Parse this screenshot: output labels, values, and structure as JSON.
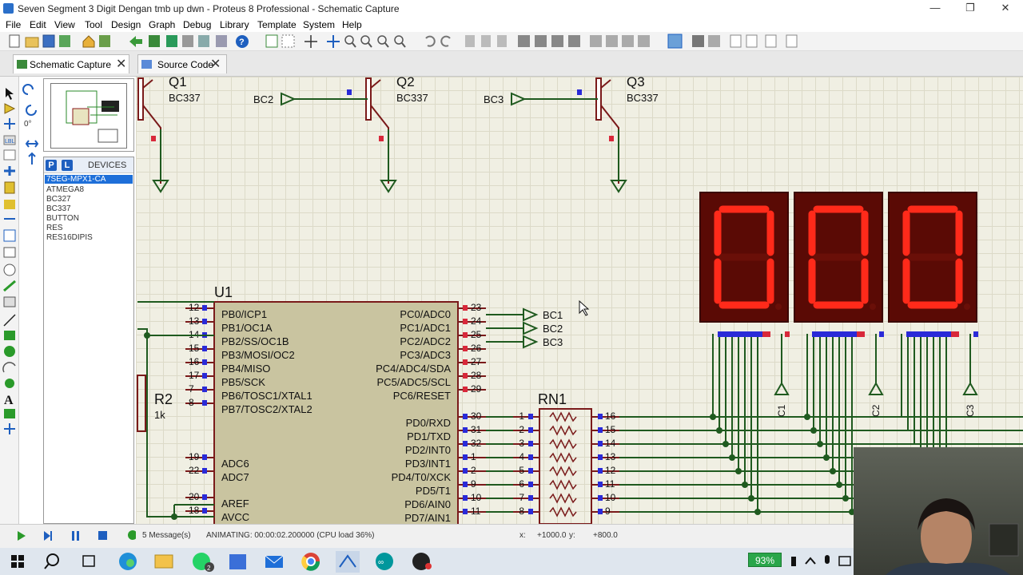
{
  "window": {
    "title": "Seven Segment 3 Digit Dengan tmb up dwn - Proteus 8 Professional - Schematic Capture",
    "minimize": "—",
    "restore": "❐",
    "close": "✕"
  },
  "menu": [
    "File",
    "Edit",
    "View",
    "Tool",
    "Design",
    "Graph",
    "Debug",
    "Library",
    "Template",
    "System",
    "Help"
  ],
  "tabs": [
    {
      "label": "Schematic Capture",
      "close": "✕"
    },
    {
      "label": "Source Code",
      "close": "✕"
    }
  ],
  "left_panel": {
    "rotation": "0°",
    "device_mode_p": "P",
    "device_mode_l": "L",
    "devices_title": "DEVICES",
    "devices": [
      "7SEG-MPX1-CA",
      "ATMEGA8",
      "BC327",
      "BC337",
      "BUTTON",
      "RES",
      "RES16DIPIS"
    ]
  },
  "schematic": {
    "transistors": [
      {
        "ref": "Q1",
        "value": "BC337",
        "input": ""
      },
      {
        "ref": "Q2",
        "value": "BC337",
        "input": "BC2"
      },
      {
        "ref": "Q3",
        "value": "BC337",
        "input": "BC3"
      }
    ],
    "mcu_ref": "U1",
    "mcu_left_pins": [
      {
        "num": "12",
        "name": "PB0/ICP1"
      },
      {
        "num": "13",
        "name": "PB1/OC1A"
      },
      {
        "num": "14",
        "name": "PB2/SS/OC1B"
      },
      {
        "num": "15",
        "name": "PB3/MOSI/OC2"
      },
      {
        "num": "16",
        "name": "PB4/MISO"
      },
      {
        "num": "17",
        "name": "PB5/SCK"
      },
      {
        "num": "7",
        "name": "PB6/TOSC1/XTAL1"
      },
      {
        "num": "8",
        "name": "PB7/TOSC2/XTAL2"
      },
      {
        "num": "19",
        "name": "ADC6"
      },
      {
        "num": "22",
        "name": "ADC7"
      },
      {
        "num": "20",
        "name": "AREF"
      },
      {
        "num": "18",
        "name": "AVCC"
      }
    ],
    "mcu_right_pins": [
      {
        "num": "23",
        "name": "PC0/ADC0"
      },
      {
        "num": "24",
        "name": "PC1/ADC1"
      },
      {
        "num": "25",
        "name": "PC2/ADC2"
      },
      {
        "num": "26",
        "name": "PC3/ADC3"
      },
      {
        "num": "27",
        "name": "PC4/ADC4/SDA"
      },
      {
        "num": "28",
        "name": "PC5/ADC5/SCL"
      },
      {
        "num": "29",
        "name": "PC6/RESET"
      },
      {
        "num": "30",
        "name": "PD0/RXD"
      },
      {
        "num": "31",
        "name": "PD1/TXD"
      },
      {
        "num": "32",
        "name": "PD2/INT0"
      },
      {
        "num": "1",
        "name": "PD3/INT1"
      },
      {
        "num": "2",
        "name": "PD4/T0/XCK"
      },
      {
        "num": "9",
        "name": "PD5/T1"
      },
      {
        "num": "10",
        "name": "PD6/AIN0"
      },
      {
        "num": "11",
        "name": "PD7/AIN1"
      }
    ],
    "bc_labels": [
      "BC1",
      "BC2",
      "BC3"
    ],
    "resistor": {
      "ref": "R2",
      "value": "1k"
    },
    "rn_ref": "RN1",
    "rn_left": [
      "1",
      "2",
      "3",
      "4",
      "5",
      "6",
      "7",
      "8"
    ],
    "rn_right": [
      "16",
      "15",
      "14",
      "13",
      "12",
      "11",
      "10",
      "9"
    ],
    "display_digits": [
      "0",
      "0",
      "0"
    ],
    "display_commons": [
      "C1",
      "C2",
      "C3"
    ],
    "segment_on_color": "#ff2a1a",
    "segment_off_color": "#6a0f08",
    "display_bg": "#5a0a05"
  },
  "status": {
    "messages": "5 Message(s)",
    "animating": "ANIMATING: 00:00:02.200000 (CPU load 36%)",
    "x_label": "x:",
    "x_value": "+1000.0",
    "y_label": "y:",
    "y_value": "+800.0"
  },
  "taskbar": {
    "battery": "93%"
  }
}
